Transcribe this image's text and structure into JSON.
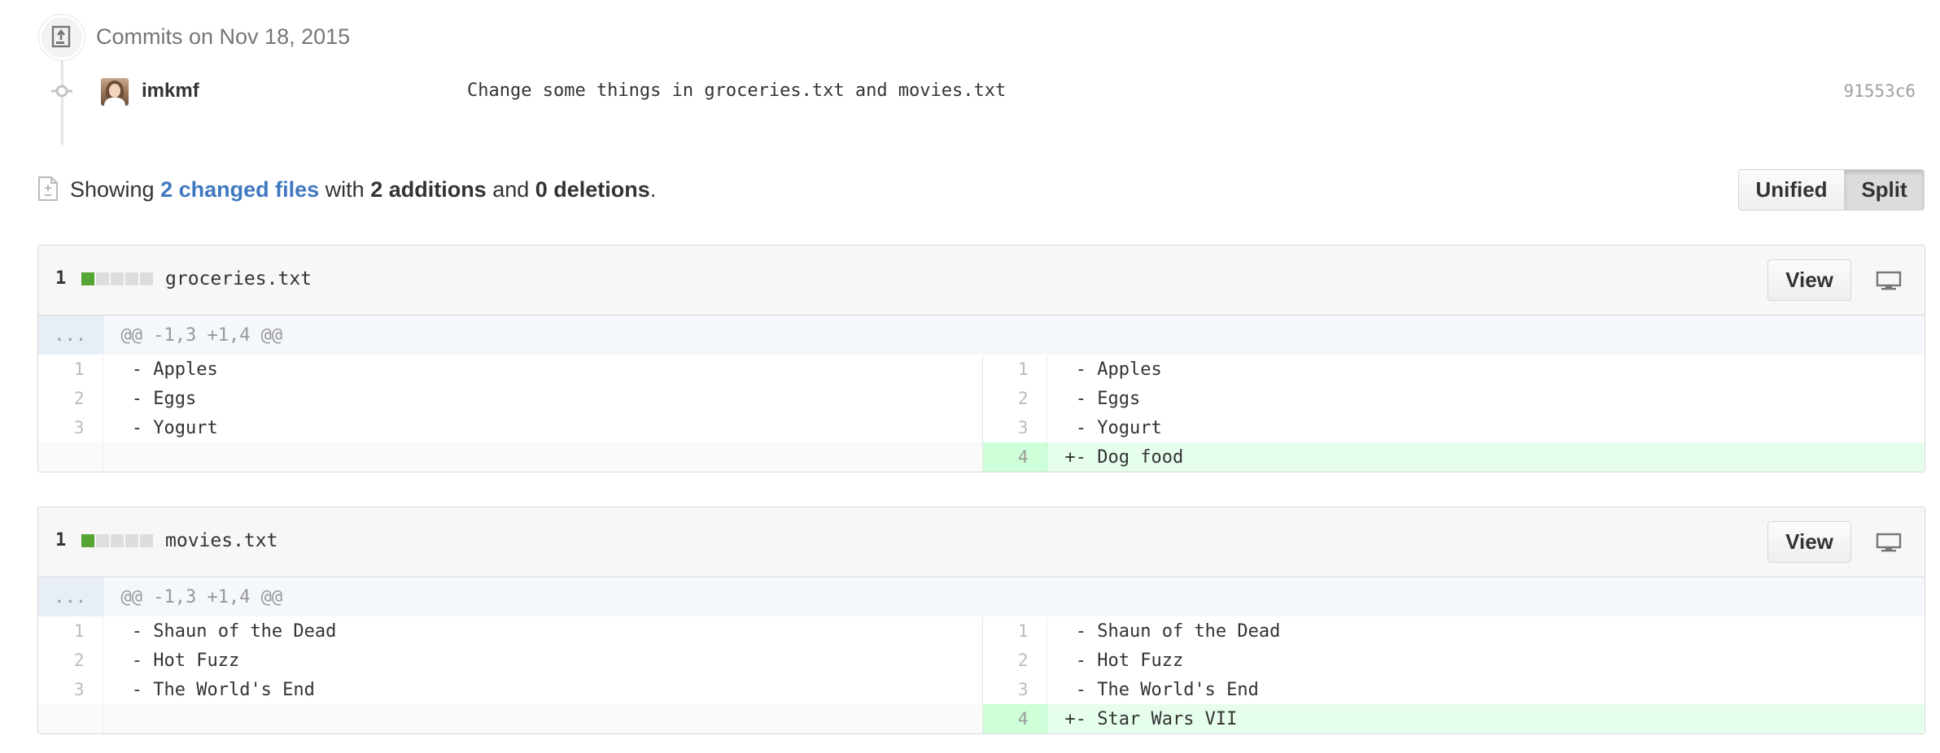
{
  "commits": {
    "group_title": "Commits on Nov 18, 2015",
    "author": "imkmf",
    "message": "Change some things in groceries.txt and movies.txt",
    "sha": "91553c6"
  },
  "toc": {
    "showing": "Showing ",
    "changed_files": "2 changed files",
    "with": " with ",
    "additions": "2 additions",
    "and": " and ",
    "deletions": "0 deletions",
    "period": "."
  },
  "view_toggle": {
    "unified": "Unified",
    "split": "Split",
    "selected": "Split"
  },
  "files": [
    {
      "count": "1",
      "name": "groceries.txt",
      "view_label": "View",
      "diffstat": [
        "add",
        "neutral",
        "neutral",
        "neutral",
        "neutral"
      ],
      "hunk_expand": "...",
      "hunk_header": "@@ -1,3 +1,4 @@",
      "rows": [
        {
          "left_num": "1",
          "left_code": " - Apples",
          "right_num": "1",
          "right_code": " - Apples"
        },
        {
          "left_num": "2",
          "left_code": " - Eggs",
          "right_num": "2",
          "right_code": " - Eggs"
        },
        {
          "left_num": "3",
          "left_code": " - Yogurt",
          "right_num": "3",
          "right_code": " - Yogurt"
        },
        {
          "left_num": "",
          "left_code": "",
          "right_num": "4",
          "right_code": "+- Dog food"
        }
      ]
    },
    {
      "count": "1",
      "name": "movies.txt",
      "view_label": "View",
      "diffstat": [
        "add",
        "neutral",
        "neutral",
        "neutral",
        "neutral"
      ],
      "hunk_expand": "...",
      "hunk_header": "@@ -1,3 +1,4 @@",
      "rows": [
        {
          "left_num": "1",
          "left_code": " - Shaun of the Dead",
          "right_num": "1",
          "right_code": " - Shaun of the Dead"
        },
        {
          "left_num": "2",
          "left_code": " - Hot Fuzz",
          "right_num": "2",
          "right_code": " - Hot Fuzz"
        },
        {
          "left_num": "3",
          "left_code": " - The World's End",
          "right_num": "3",
          "right_code": " - The World's End"
        },
        {
          "left_num": "",
          "left_code": "",
          "right_num": "4",
          "right_code": "+- Star Wars VII"
        }
      ]
    }
  ],
  "icons": {
    "commit_group": "git-commit-group-icon",
    "commit_node": "git-commit-icon",
    "toc": "file-diff-icon",
    "display": "desktop-display-icon"
  },
  "colors": {
    "link": "#4078c0",
    "addition_line_bg": "#e6ffed",
    "addition_num_bg": "#cdffd8",
    "diffstat_add": "#55a532",
    "diffstat_neutral": "#dddddd",
    "hunk_bg": "#f4f7fb"
  }
}
